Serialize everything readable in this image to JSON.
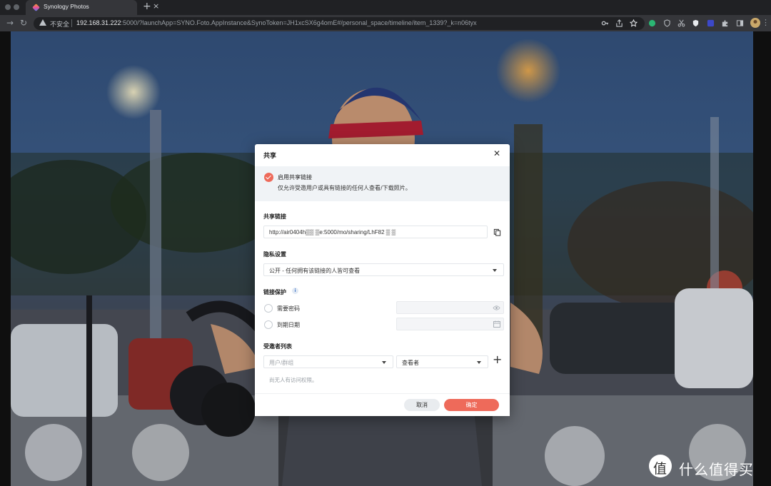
{
  "browser": {
    "tab_title": "Synology Photos",
    "insecure_label": "不安全",
    "url_host": "192.168.31.222",
    "url_rest": ":5000/?launchApp=SYNO.Foto.AppInstance&SynoToken=JH1xcSX6g4omE#/personal_space/timeline/item_1339?_k=n06tyx"
  },
  "dialog": {
    "title": "共享",
    "enable_label": "启用共享链接",
    "enable_desc": "仅允许受邀用户或具有链接的任何人查看/下载照片。",
    "share_link_label": "共享链接",
    "share_link_value": "http://air0404h▒▒ ▒e:5000/mo/sharing/LhF82 ▒ ▒",
    "privacy_label": "隐私设置",
    "privacy_value": "公开 - 任何拥有该链接的人皆可查看",
    "protection_label": "链接保护",
    "protection_info": "i",
    "require_password": "需要密码",
    "expiry_date": "到期日期",
    "invitees_label": "受邀者列表",
    "user_group_placeholder": "用户/群组",
    "role_value": "查看者",
    "add_symbol": "+",
    "no_access_note": "尚无人有访问权限。",
    "cancel": "取消",
    "ok": "确定"
  },
  "watermark": {
    "icon_char": "值",
    "text": "什么值得买"
  }
}
